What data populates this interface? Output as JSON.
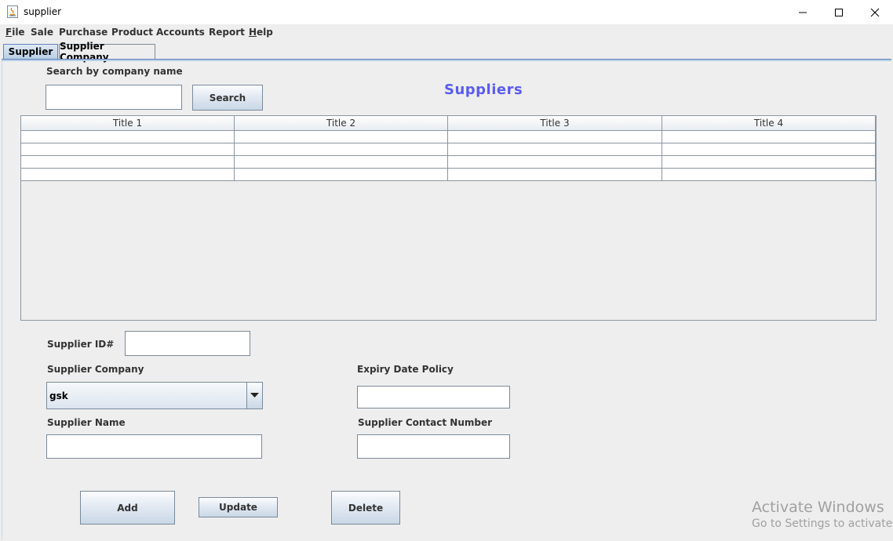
{
  "window": {
    "title": "supplier"
  },
  "menu": [
    "File",
    "Sale",
    "Purchase",
    "Product",
    "Accounts",
    "Report",
    "Help"
  ],
  "tabs": [
    {
      "label": "Supplier",
      "active": true
    },
    {
      "label": "Supplier Company",
      "active": false
    }
  ],
  "search": {
    "label": "Search by company name",
    "value": "",
    "button": "Search"
  },
  "heading": "Suppliers",
  "table": {
    "columns": [
      "Title 1",
      "Title 2",
      "Title 3",
      "Title 4"
    ],
    "rows": [
      [
        "",
        "",
        "",
        ""
      ],
      [
        "",
        "",
        "",
        ""
      ],
      [
        "",
        "",
        "",
        ""
      ],
      [
        "",
        "",
        "",
        ""
      ]
    ]
  },
  "form": {
    "supplier_id_label": "Supplier ID#",
    "supplier_id_value": "",
    "supplier_company_label": "Supplier Company",
    "supplier_company_value": "gsk",
    "expiry_label": "Expiry Date Policy",
    "expiry_value": "",
    "supplier_name_label": "Supplier Name",
    "supplier_name_value": "",
    "contact_label": "Supplier Contact Number",
    "contact_value": ""
  },
  "buttons": {
    "add": "Add",
    "update": "Update",
    "delete": "Delete"
  },
  "watermark": {
    "line1": "Activate Windows",
    "line2": "Go to Settings to activate Windows."
  },
  "colors": {
    "heading": "#5b5bf0",
    "tab_active": "#b8cfe5"
  }
}
